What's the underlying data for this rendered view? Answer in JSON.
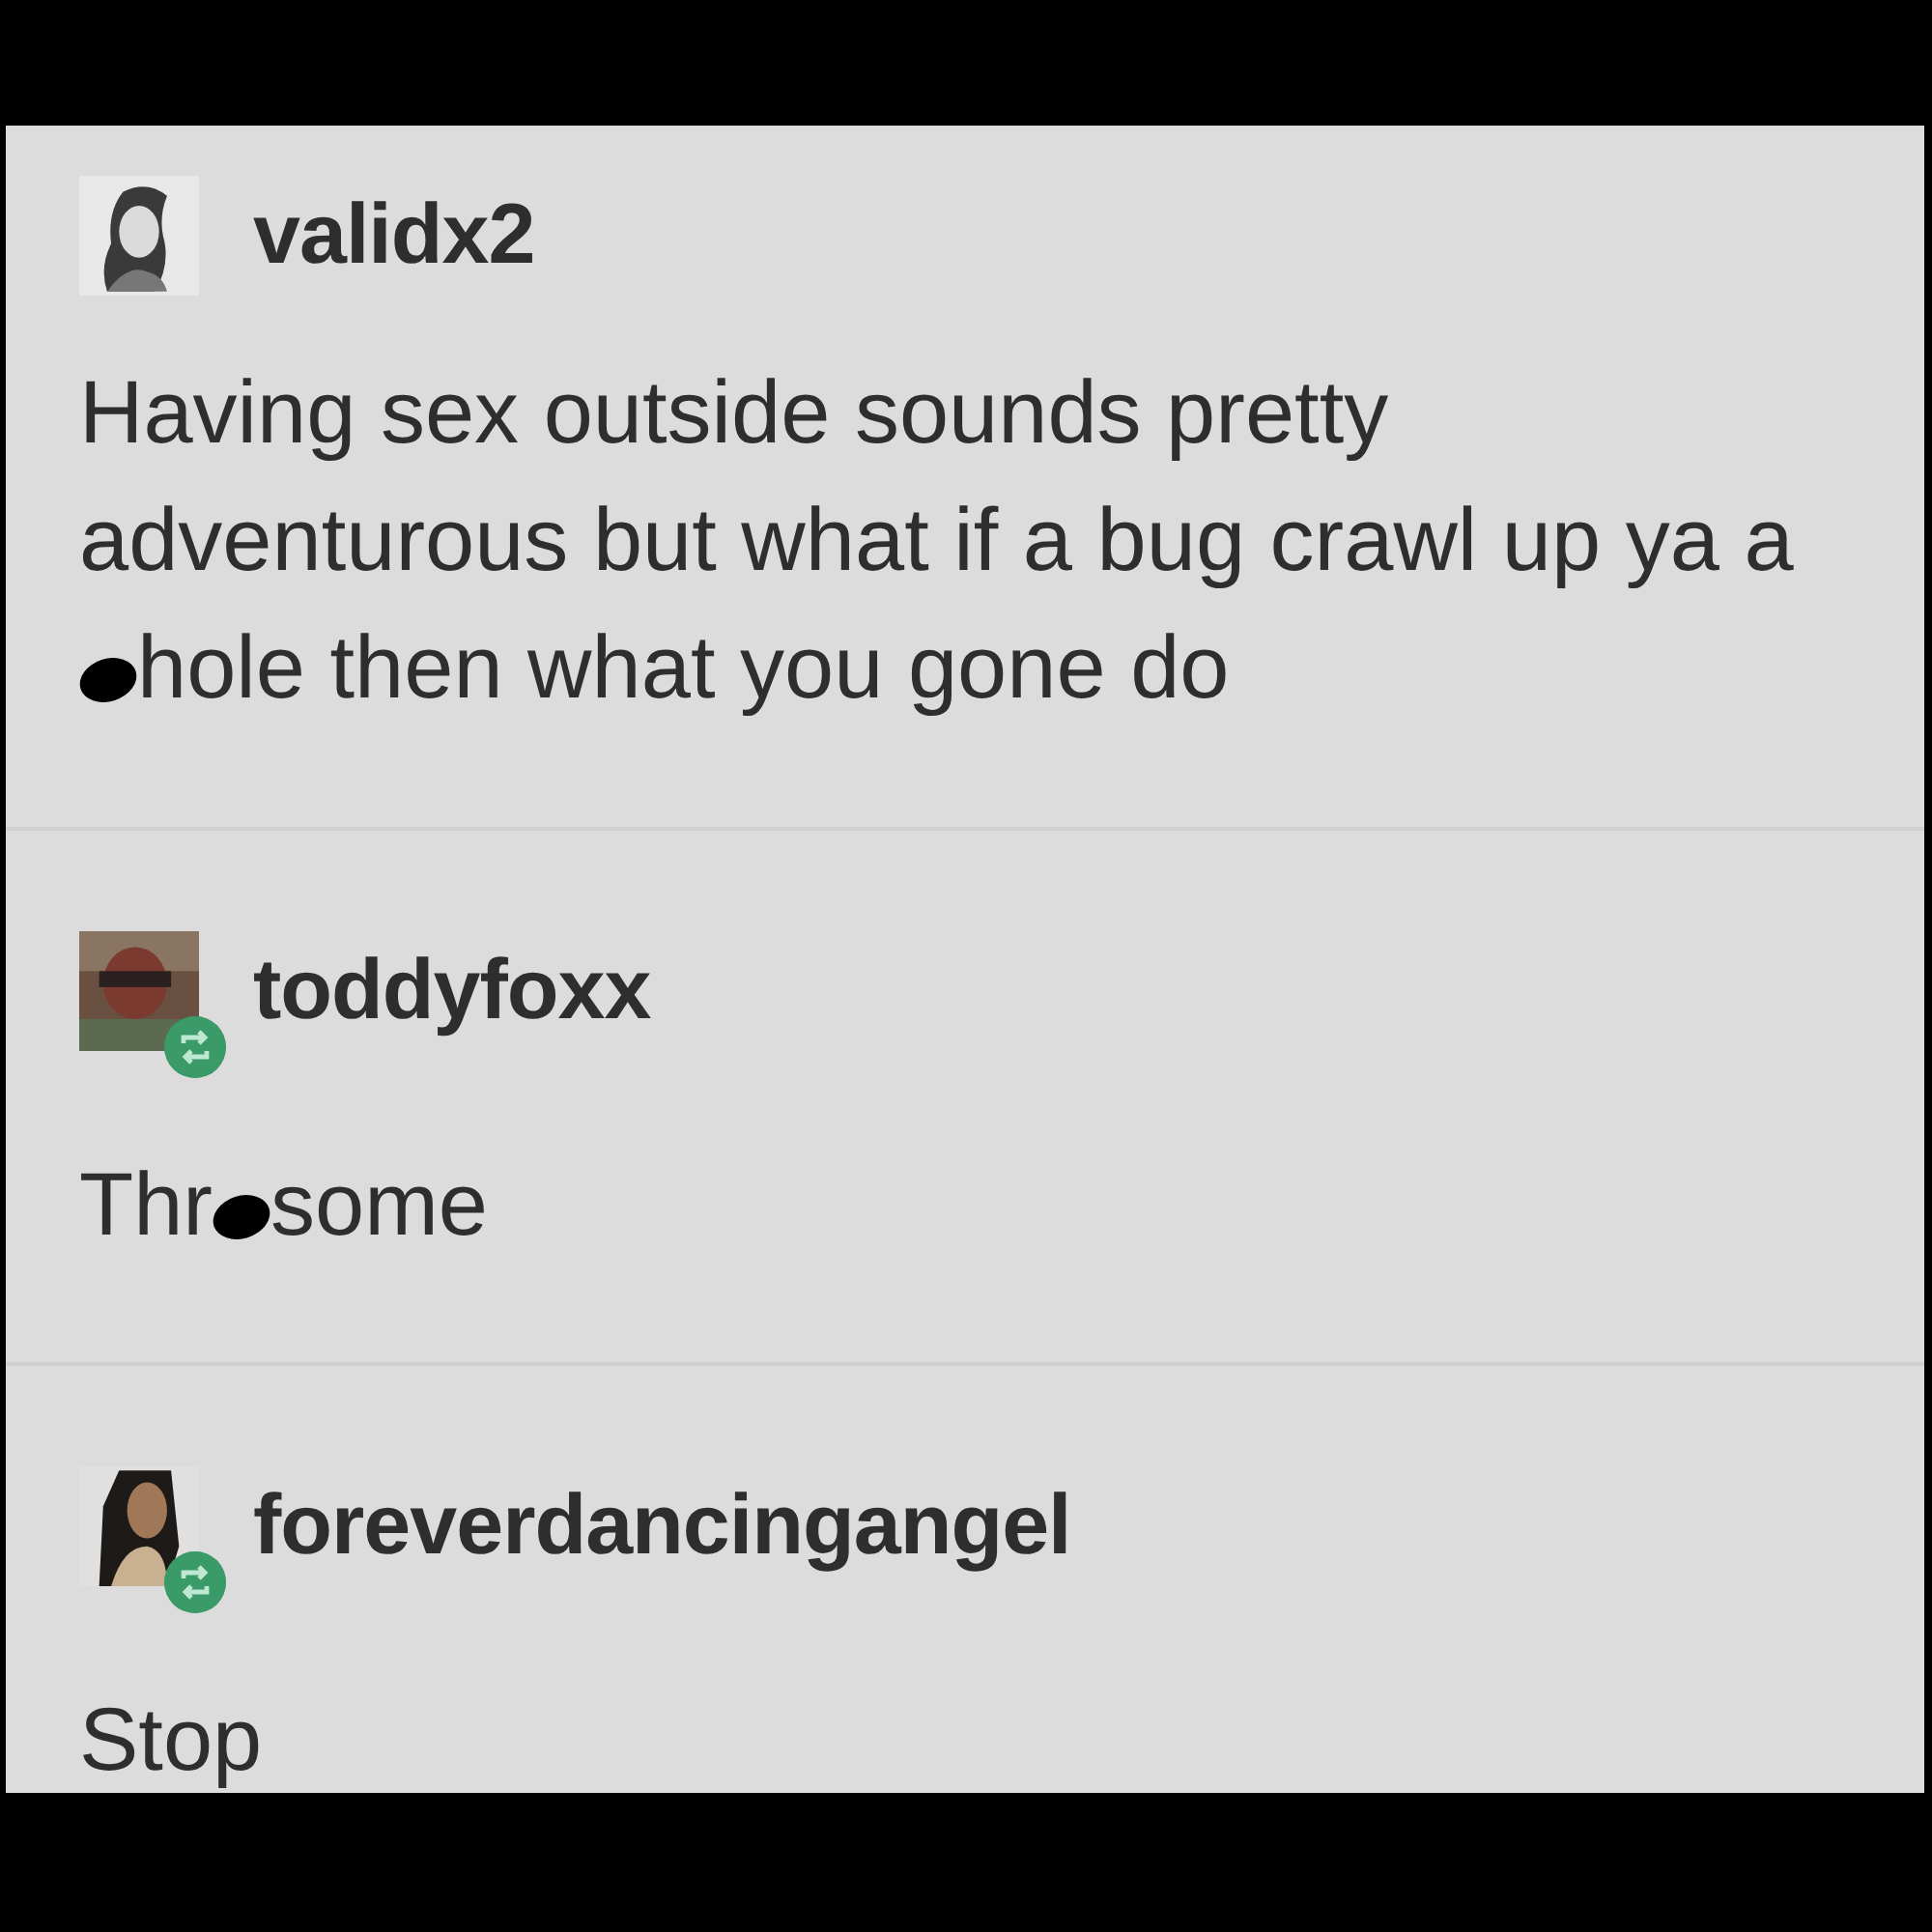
{
  "posts": [
    {
      "username": "validx2",
      "reblogged": false,
      "body": [
        {
          "kind": "text",
          "text": "Having sex outside sounds pretty adventurous but what if a bug crawl up ya a"
        },
        {
          "kind": "censor"
        },
        {
          "kind": "text",
          "text": "hole then what you gone do"
        }
      ]
    },
    {
      "username": "toddyfoxx",
      "reblogged": true,
      "body": [
        {
          "kind": "text",
          "text": "Thr"
        },
        {
          "kind": "censor"
        },
        {
          "kind": "text",
          "text": "some"
        }
      ]
    },
    {
      "username": "foreverdancingangel",
      "reblogged": true,
      "body": [
        {
          "kind": "text",
          "text": "Stop"
        }
      ]
    }
  ]
}
